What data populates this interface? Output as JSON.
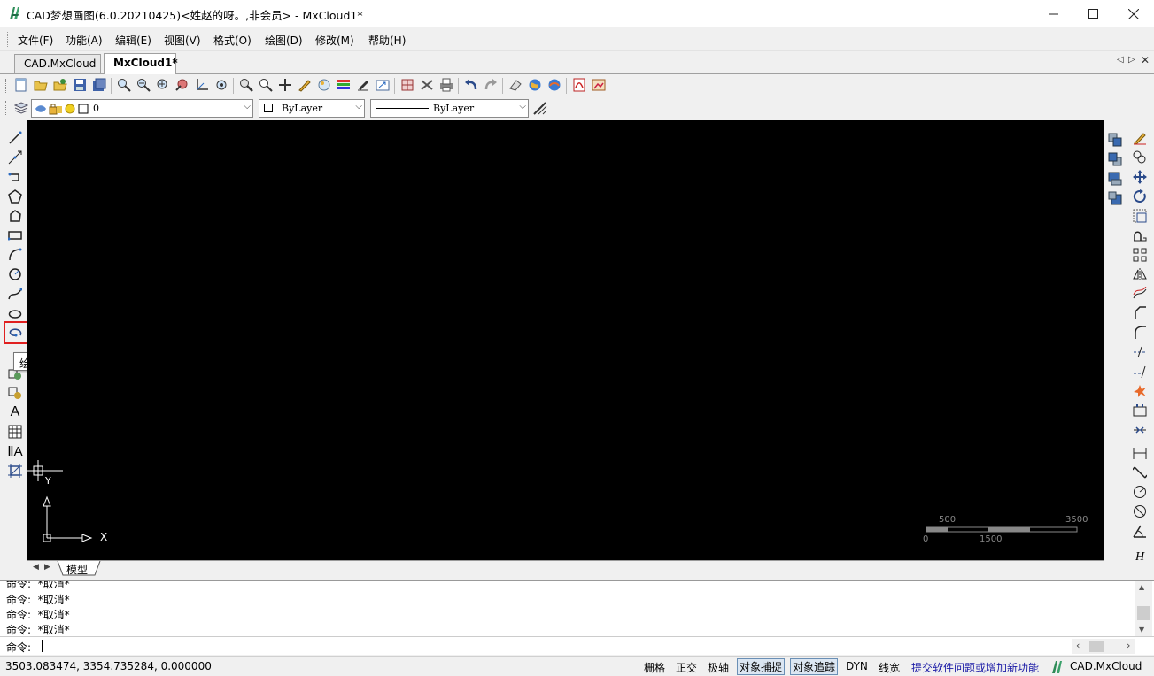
{
  "window": {
    "title": "CAD梦想画图(6.0.20210425)<姓赵的呀。,非会员> - MxCloud1*"
  },
  "menu": [
    "文件(F)",
    "功能(A)",
    "编辑(E)",
    "视图(V)",
    "格式(O)",
    "绘图(D)",
    "修改(M)",
    "帮助(H)"
  ],
  "tabs": [
    {
      "label": "CAD.MxCloud",
      "active": false
    },
    {
      "label": "MxCloud1*",
      "active": true
    }
  ],
  "layer_bar": {
    "layer_name": "0",
    "color": "ByLayer",
    "linetype": "ByLayer"
  },
  "tooltip": "绘椭圆弧命令",
  "canvas": {
    "ucs_x_label": "X",
    "ucs_y_label": "Y",
    "crosshair_y_label": "Y",
    "scale_bar": {
      "top_labels": [
        "500",
        "3500"
      ],
      "bottom_labels": [
        "0",
        "1500"
      ]
    }
  },
  "sheet_tab": "模型",
  "command_history": [
    "命令:  *取消*",
    "命令:  *取消*",
    "命令:  *取消*",
    "命令:  *取消*"
  ],
  "command_prompt": "命令:",
  "status": {
    "coordinates": "3503.083474,  3354.735284,  0.000000",
    "toggles": [
      {
        "label": "栅格",
        "on": false
      },
      {
        "label": "正交",
        "on": false
      },
      {
        "label": "极轴",
        "on": false
      },
      {
        "label": "对象捕捉",
        "on": true
      },
      {
        "label": "对象追踪",
        "on": true
      },
      {
        "label": "DYN",
        "on": false
      },
      {
        "label": "线宽",
        "on": false
      }
    ],
    "feedback_link": "提交软件问题或增加新功能",
    "brand": "CAD.MxCloud"
  },
  "colors": {
    "canvas_bg": "#000000",
    "highlight_red": "#e02020",
    "link_blue": "#1a1aa6",
    "brand_green": "#2e8b57"
  }
}
